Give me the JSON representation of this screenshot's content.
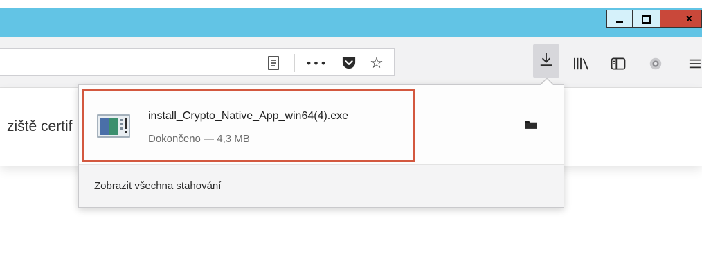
{
  "window": {
    "minimize_icon": "minimize-icon",
    "maximize_icon": "restore-icon",
    "close_label": "x",
    "accent_color": "#62c4e5",
    "close_color": "#c9483a"
  },
  "toolbar": {
    "icons": [
      "reader-view-icon",
      "page-actions-icon",
      "pocket-icon",
      "bookmark-star-icon",
      "downloads-icon",
      "library-icon",
      "sidebar-icon",
      "extension-icon",
      "hamburger-menu-icon"
    ],
    "more_label": "•••"
  },
  "page": {
    "partial_text": "ziště certif"
  },
  "downloads_panel": {
    "item": {
      "file_name": "install_Crypto_Native_App_win64(4).exe",
      "status": "Dokončeno — 4,3 MB",
      "highlight_color": "#d3583f"
    },
    "footer_prefix": "Zobrazit ",
    "footer_accel": "v",
    "footer_suffix": "šechna stahování"
  }
}
